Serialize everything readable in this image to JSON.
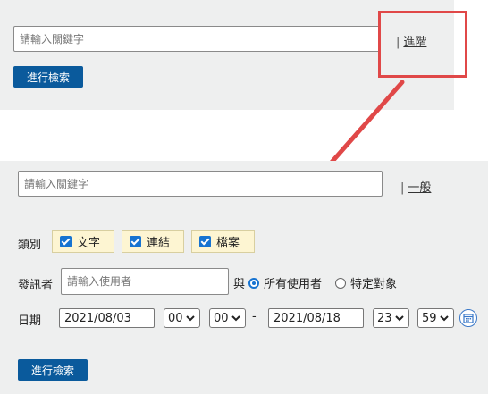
{
  "simple_search": {
    "keyword_placeholder": "請輸入關鍵字",
    "mode_link_label": "進階",
    "search_button": "進行檢索"
  },
  "advanced_search": {
    "keyword_placeholder": "請輸入關鍵字",
    "mode_link_label": "一般",
    "category": {
      "label": "類別",
      "options": [
        {
          "label": "文字",
          "checked": true
        },
        {
          "label": "連結",
          "checked": true
        },
        {
          "label": "檔案",
          "checked": true
        }
      ]
    },
    "poster": {
      "label": "發訊者",
      "placeholder": "請輸入使用者",
      "conjunction": "與",
      "radio_all": "所有使用者",
      "radio_specific": "特定對象",
      "selected": "所有使用者"
    },
    "date": {
      "label": "日期",
      "start_date": "2021/08/03",
      "start_hour": "00",
      "start_minute": "00",
      "separator": "-",
      "end_date": "2021/08/18",
      "end_hour": "23",
      "end_minute": "59"
    },
    "search_button": "進行檢索"
  },
  "colors": {
    "panel_bg": "#eeefef",
    "primary_button": "#0a5a9c",
    "chip_bg": "#fdf5d2",
    "checkbox_blue": "#1673d1",
    "annotation_red": "#e04848"
  }
}
